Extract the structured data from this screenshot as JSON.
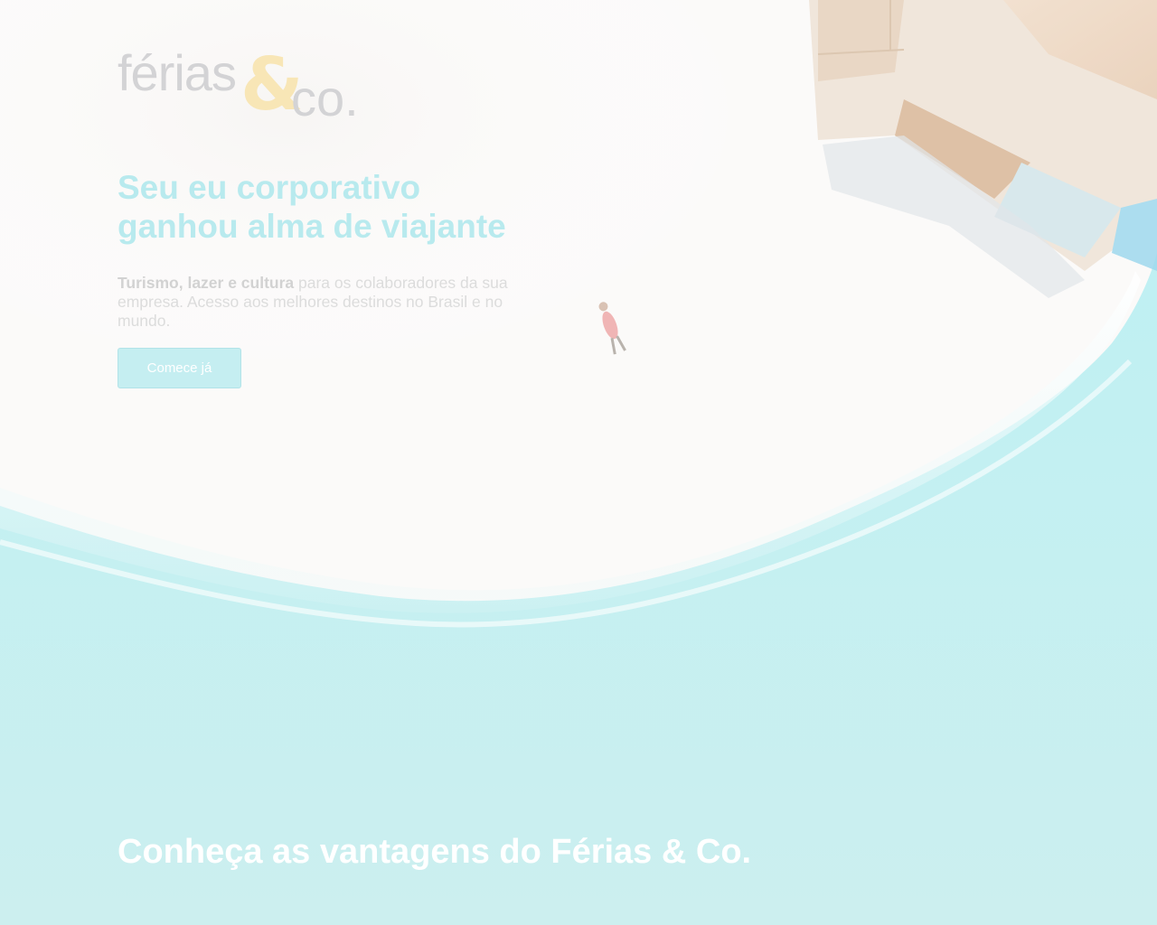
{
  "brand": {
    "logo_ferias": "férias",
    "logo_amp": "&",
    "logo_co": "co."
  },
  "hero": {
    "headline_line1": "Seu eu corporativo",
    "headline_line2": "ganhou alma de viajante",
    "description_strong": "Turismo, lazer e cultura",
    "description_rest": " para os colaboradores da sua empresa. Acesso aos melhores destinos no Brasil e no mundo.",
    "cta_label": "Comece já"
  },
  "advantages": {
    "title": "Conheça as vantagens do Férias & Co."
  },
  "colors": {
    "accent": "#b8eaee",
    "logo_amp": "#f8e6b6",
    "sea": "#ccefef",
    "sand": "#fbfafa"
  },
  "icons": {
    "hero_background": "beach-aerial-photo"
  }
}
